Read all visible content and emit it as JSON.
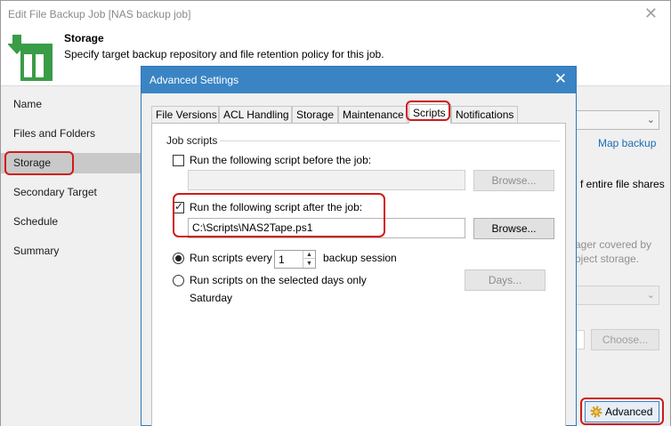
{
  "bg_window": {
    "title": "Edit File Backup Job [NAS backup job]",
    "close_glyph": "✕",
    "header_title": "Storage",
    "header_subtitle": "Specify target backup repository and file retention policy for this job.",
    "header_icon": "storage-icon"
  },
  "nav": {
    "items": [
      {
        "label": "Name"
      },
      {
        "label": "Files and Folders"
      },
      {
        "label": "Storage",
        "active": true
      },
      {
        "label": "Secondary Target"
      },
      {
        "label": "Schedule"
      },
      {
        "label": "Summary"
      }
    ]
  },
  "right_panel": {
    "map_backup_link": "Map backup",
    "partial_text1": "f entire file shares",
    "partial_gray1": "ager covered by",
    "partial_gray2": "bject storage.",
    "choose_button": "Choose...",
    "advanced_button": "Advanced"
  },
  "dialog": {
    "title": "Advanced Settings",
    "close_glyph": "✕",
    "tabs": [
      "File Versions",
      "ACL Handling",
      "Storage",
      "Maintenance",
      "Scripts",
      "Notifications"
    ],
    "active_tab": "Scripts",
    "group_label": "Job scripts",
    "before": {
      "label": "Run the following script before the job:",
      "checked": false,
      "value": "",
      "browse": "Browse..."
    },
    "after": {
      "label": "Run the following script after the job:",
      "checked": true,
      "value": "C:\\Scripts\\NAS2Tape.ps1",
      "browse": "Browse..."
    },
    "run_every": {
      "label": "Run scripts every",
      "value": "1",
      "suffix": "backup session",
      "selected": true
    },
    "run_days": {
      "label": "Run scripts on the selected days only",
      "days_value": "Saturday",
      "days_button": "Days..."
    }
  },
  "colors": {
    "dialog_title_bar": "#3a84c4",
    "highlight": "#d11a1a",
    "link": "#1c6db5"
  }
}
